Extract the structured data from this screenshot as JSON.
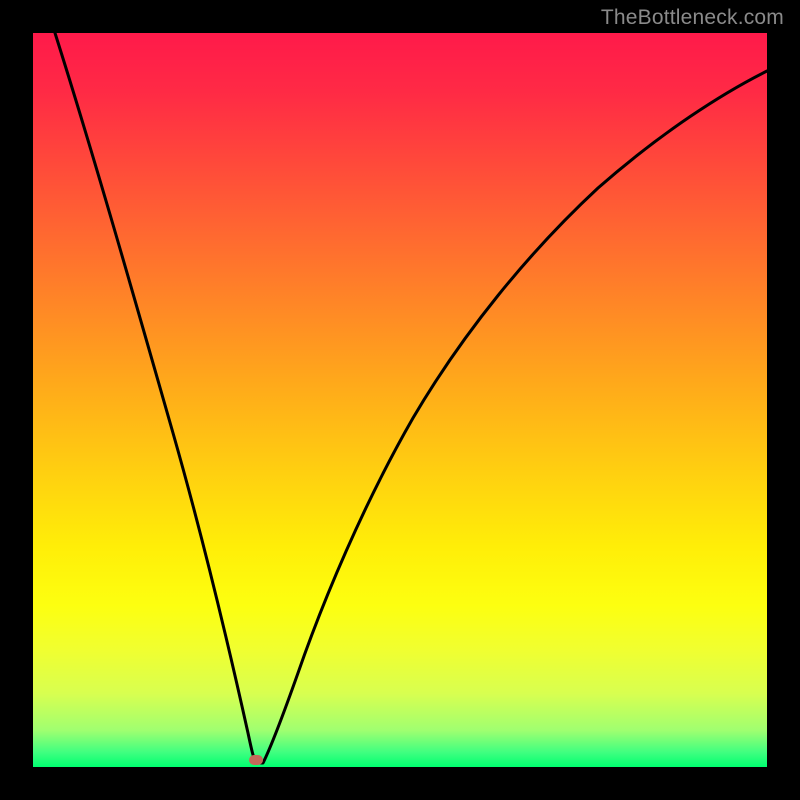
{
  "watermark": "TheBottleneck.com",
  "chart_data": {
    "type": "line",
    "title": "",
    "xlabel": "",
    "ylabel": "",
    "xlim": [
      0,
      100
    ],
    "ylim": [
      0,
      100
    ],
    "x": [
      3,
      5,
      8,
      11,
      14,
      17,
      20,
      23,
      26,
      29,
      30,
      30.5,
      31,
      33,
      36,
      39,
      42,
      45,
      49,
      53,
      58,
      63,
      68,
      74,
      80,
      86,
      92,
      100
    ],
    "values": [
      100,
      92,
      81,
      70,
      59,
      48,
      36,
      25,
      13,
      3,
      1,
      0,
      1,
      6,
      14,
      22,
      29,
      36,
      44,
      51,
      58,
      64,
      70,
      76,
      81,
      86,
      90,
      95
    ],
    "min_point": {
      "x": 30.5,
      "y": 0
    },
    "series": [
      {
        "name": "bottleneck-curve",
        "values": "see x/values above"
      }
    ],
    "grid": false,
    "legend": false
  },
  "colors": {
    "bg": "#000000",
    "curve": "#000000",
    "marker": "#c46a5a",
    "gradient_top": "#ff1a4a",
    "gradient_bottom": "#00ff70"
  }
}
